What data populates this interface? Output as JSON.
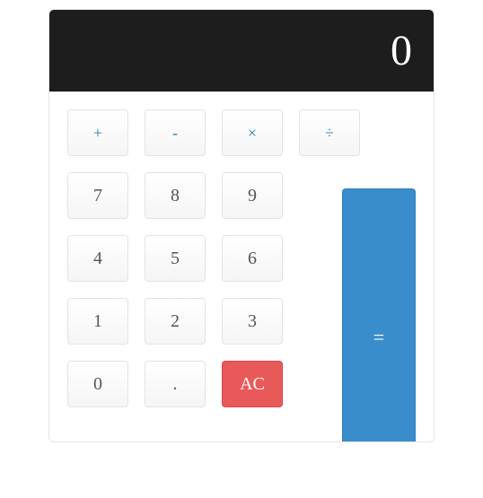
{
  "display": "0",
  "ops": {
    "add": "+",
    "sub": "-",
    "mul": "×",
    "div": "÷"
  },
  "digits": {
    "d7": "7",
    "d8": "8",
    "d9": "9",
    "d4": "4",
    "d5": "5",
    "d6": "6",
    "d1": "1",
    "d2": "2",
    "d3": "3",
    "d0": "0"
  },
  "decimal": ".",
  "clear": "AC",
  "equals": "="
}
